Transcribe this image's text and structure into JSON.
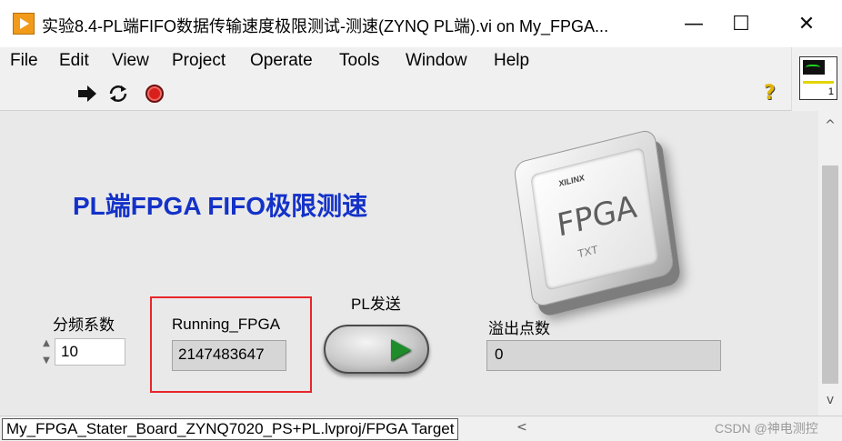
{
  "window": {
    "title": "实验8.4-PL端FIFO数据传输速度极限测试-测速(ZYNQ PL端).vi on My_FPGA...",
    "controls": {
      "minimize": "—",
      "maximize": "☐",
      "close": "✕"
    }
  },
  "menu": {
    "items": [
      "File",
      "Edit",
      "View",
      "Project",
      "Operate",
      "Tools",
      "Window",
      "Help"
    ]
  },
  "toolbar": {
    "run_icon": "run-arrow-icon",
    "run_continuous_icon": "run-continuously-icon",
    "abort_icon": "abort-stop-icon",
    "help_glyph": "?"
  },
  "connector": {
    "number": "1"
  },
  "panel": {
    "heading": "PL端FPGA FIFO极限测速",
    "chip": {
      "label": "FPGA",
      "sub": "TXT",
      "brand": "XILINX"
    },
    "freq_divider": {
      "label": "分频系数",
      "value": "10",
      "spin_up": "▲",
      "spin_down": "▼"
    },
    "running": {
      "label": "Running_FPGA",
      "value": "2147483647"
    },
    "pl_send": {
      "label": "PL发送"
    },
    "overflow": {
      "label": "溢出点数",
      "value": "0"
    },
    "highlight_color": "#e8262a",
    "heading_color": "#1432c8"
  },
  "status": {
    "path": "My_FPGA_Stater_Board_ZYNQ7020_PS+PL.lvproj/FPGA Target",
    "scroll_left": "<",
    "scroll_up": "^",
    "scroll_down": "v",
    "watermark": "CSDN @神电测控"
  }
}
